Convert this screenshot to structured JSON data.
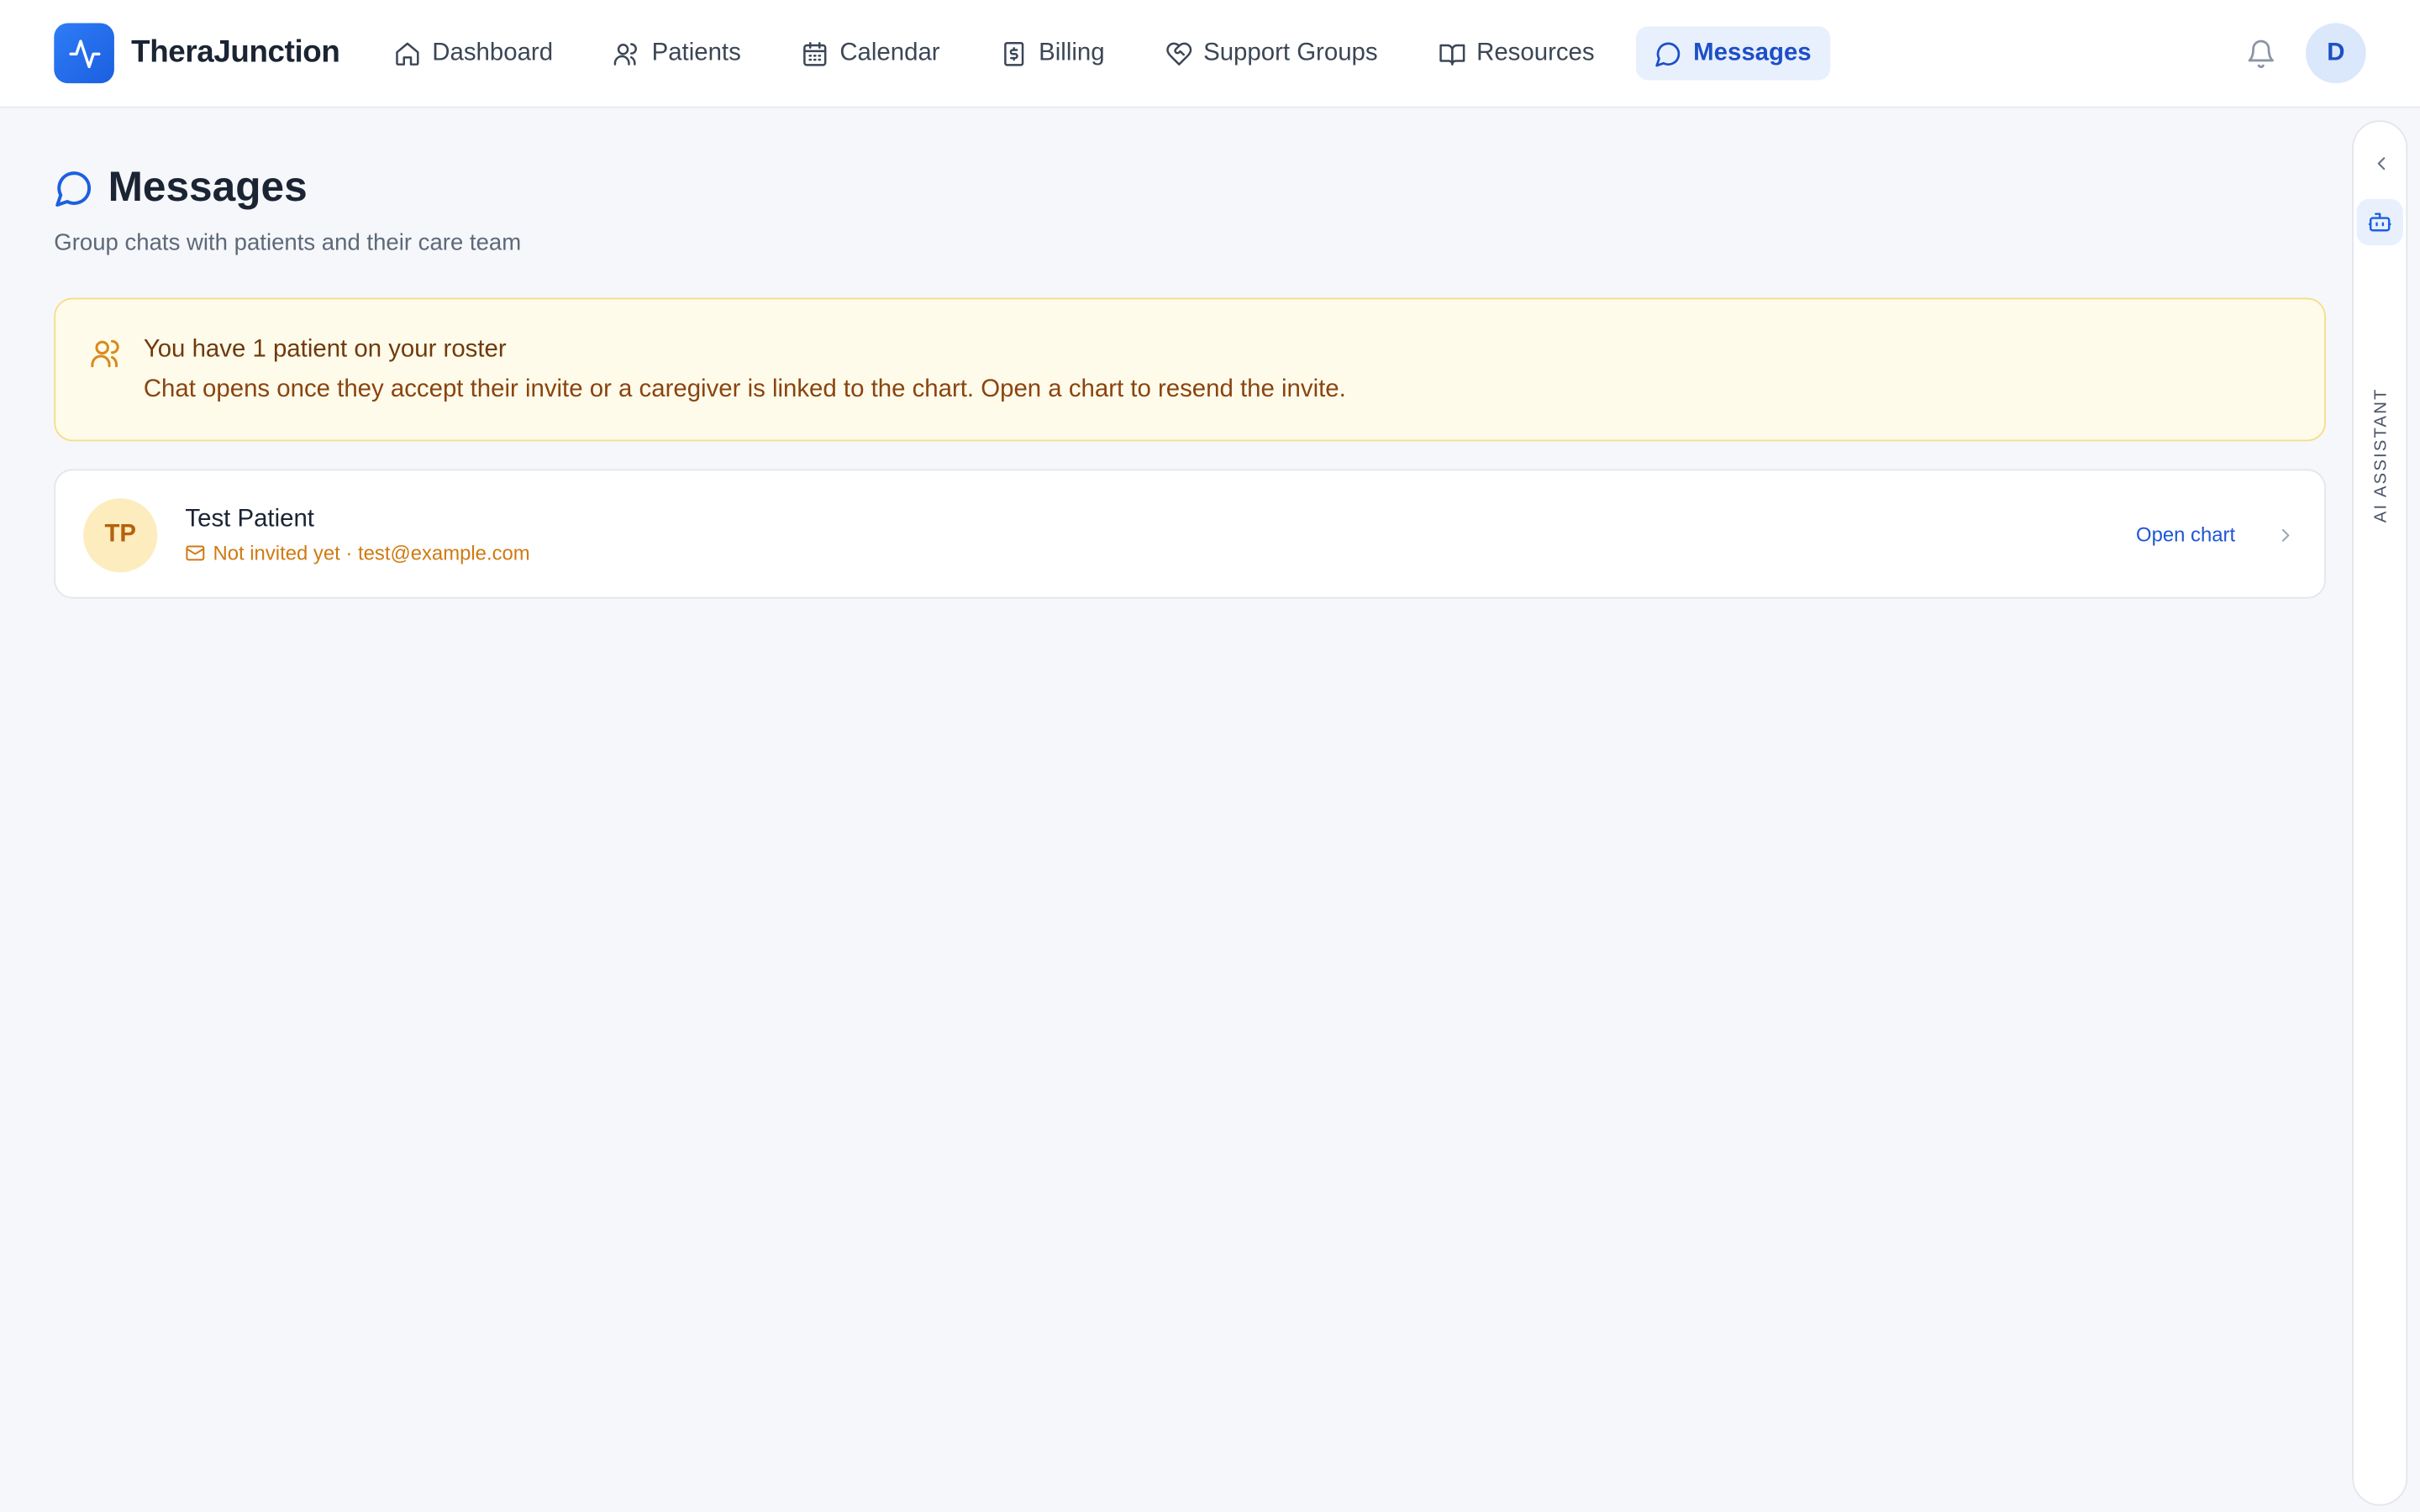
{
  "app": {
    "name": "TheraJunction"
  },
  "nav": {
    "items": [
      {
        "label": "Dashboard",
        "icon": "home-icon"
      },
      {
        "label": "Patients",
        "icon": "users-icon"
      },
      {
        "label": "Calendar",
        "icon": "calendar-icon"
      },
      {
        "label": "Billing",
        "icon": "receipt-icon"
      },
      {
        "label": "Support Groups",
        "icon": "heart-handshake-icon"
      },
      {
        "label": "Resources",
        "icon": "book-icon"
      },
      {
        "label": "Messages",
        "icon": "message-icon",
        "active": true
      }
    ],
    "user_initial": "D"
  },
  "page": {
    "title": "Messages",
    "subtitle": "Group chats with patients and their care team"
  },
  "notice": {
    "title": "You have 1 patient on your roster",
    "text": "Chat opens once they accept their invite or a caregiver is linked to the chart. Open a chart to resend the invite."
  },
  "patients": [
    {
      "initials": "TP",
      "name": "Test Patient",
      "status": "Not invited yet · test@example.com",
      "action": "Open chart"
    }
  ],
  "assistant": {
    "label": "AI ASSISTANT"
  },
  "colors": {
    "accent": "#1d4fc7",
    "notice_bg": "#fffbea",
    "notice_border": "#f6dd86",
    "warning_text": "#d07a12"
  }
}
